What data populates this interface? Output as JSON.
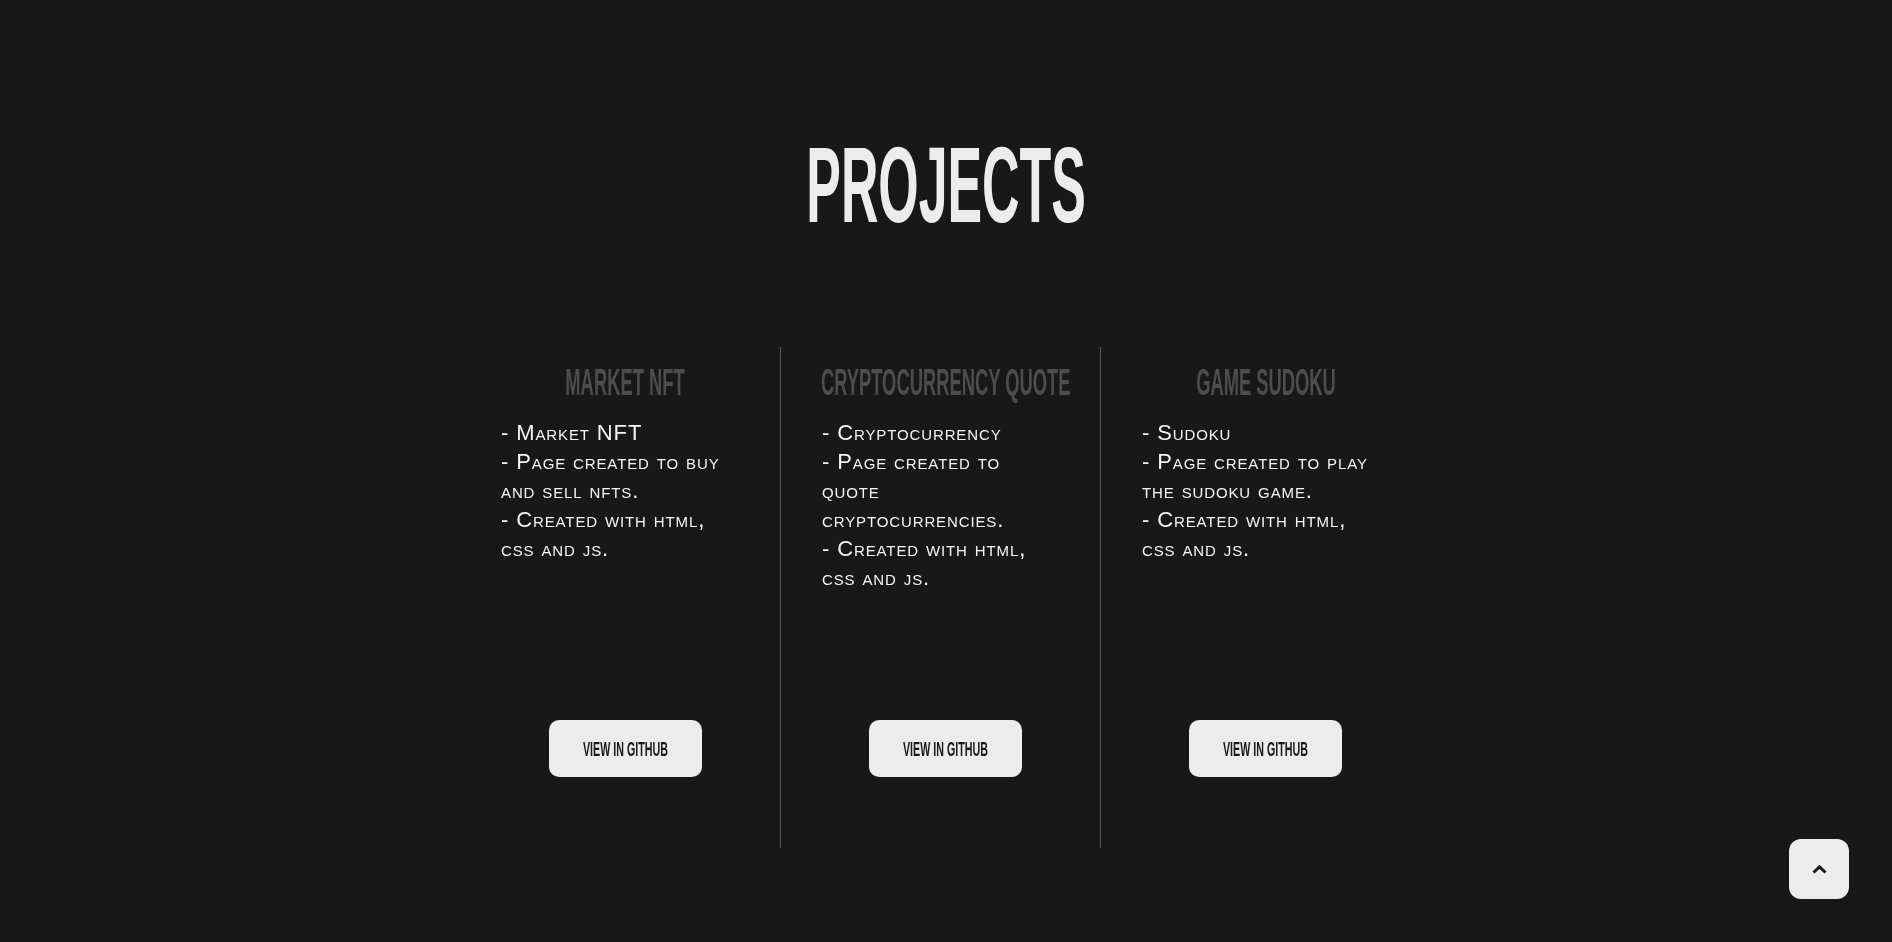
{
  "heading": "PROJECTS",
  "projects": [
    {
      "title": "MARKET NFT",
      "description": [
        "- Market NFT",
        "- Page created to buy and sell nfts.",
        "- Created with html, css and js."
      ],
      "button": "VIEW IN GITHUB"
    },
    {
      "title": "CRYPTOCURRENCY QUOTE",
      "description": [
        "- Cryptocurrency",
        "- Page created to quote cryptocurrencies.",
        "- Created with html, css and js."
      ],
      "button": "VIEW IN GITHUB"
    },
    {
      "title": "GAME SUDOKU",
      "description": [
        "- Sudoku",
        "- Page created to play the sudoku game.",
        "- Created with html, css and js."
      ],
      "button": "VIEW IN GITHUB"
    }
  ]
}
